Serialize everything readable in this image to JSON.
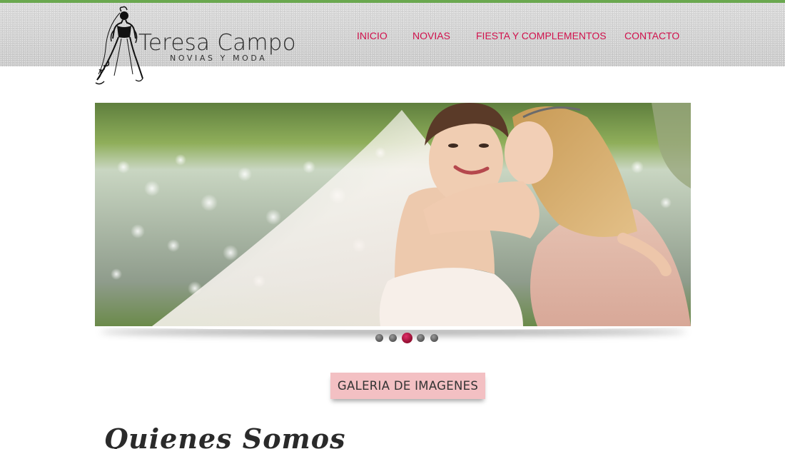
{
  "brand": {
    "name": "Teresa Campo",
    "tagline": "NOVIAS Y MODA"
  },
  "nav": {
    "items": [
      {
        "label": "INICIO"
      },
      {
        "label": "NOVIAS"
      },
      {
        "label": "FIESTA Y COMPLEMENTOS"
      },
      {
        "label": "CONTACTO"
      }
    ]
  },
  "slider": {
    "slide_count": 5,
    "active_index": 2
  },
  "gallery_button": {
    "label": "GALERIA DE IMAGENES"
  },
  "section": {
    "title": "Quienes Somos"
  },
  "colors": {
    "accent": "#d0114c",
    "top_line": "#6aa84f",
    "button_bg": "#f3c0c3",
    "header_bg": "#cfcfcf"
  },
  "icons": [
    "bride-silhouette-logo-icon"
  ]
}
